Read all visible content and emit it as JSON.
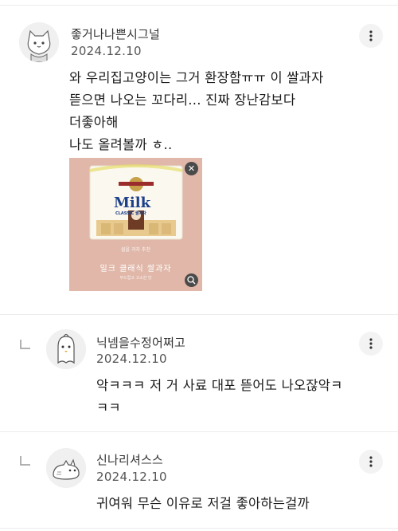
{
  "comments": [
    {
      "author": "좋거나나쁜시그널",
      "date": "2024.12.10",
      "text": "와 우리집고양이는 그거 환장함ㅠㅠ 이 쌀과자\n뜯으면 나오는 꼬다리... 진짜 장난감보다\n더좋아해\n나도 올려볼까 ㅎ..",
      "avatar_icon": "cat-avatar-icon",
      "attachment": {
        "brand_line": "쉽을 과자 추천",
        "product_name": "밀크 클래식 쌀과자",
        "sub_line": "부드럽고 고소한 맛",
        "package_title": "Milk",
        "package_subtitle": "CLASSIC 쌀과자",
        "close_symbol": "✕"
      }
    },
    {
      "author": "닉넴을수정어쩌고",
      "date": "2024.12.10",
      "text": "악ㅋㅋㅋ 저 거 사료 대포 뜯어도 나오잖악ㅋ\nㅋㅋ",
      "avatar_icon": "ghost-bird-avatar-icon"
    },
    {
      "author": "신나리셔스스",
      "date": "2024.12.10",
      "text": "귀여워 무슨 이유로 저걸 좋아하는걸까",
      "avatar_icon": "lying-cat-avatar-icon"
    }
  ],
  "colors": {
    "divider": "#ececec",
    "button_bg": "#f3f3f3",
    "attachment_bg": "#e0b7a8",
    "package_blue": "#1c3f8a"
  }
}
